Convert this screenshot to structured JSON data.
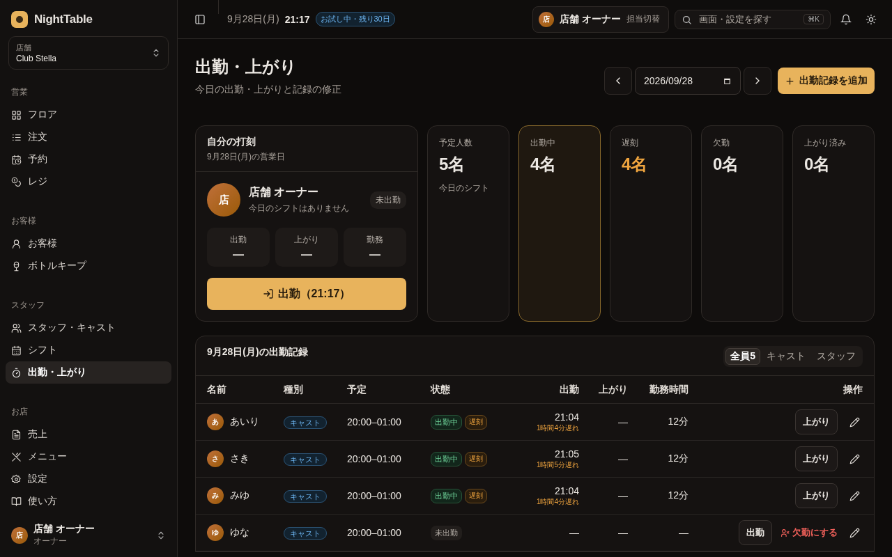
{
  "sidebar": {
    "brand": "NightTable",
    "store": {
      "label": "店舗",
      "name": "Club Stella"
    },
    "sections": [
      {
        "title": "営業",
        "items": [
          {
            "label": "フロア",
            "selected": false
          },
          {
            "label": "注文",
            "selected": false
          },
          {
            "label": "予約",
            "selected": false
          },
          {
            "label": "レジ",
            "selected": false
          }
        ]
      },
      {
        "title": "お客様",
        "items": [
          {
            "label": "お客様",
            "selected": false
          },
          {
            "label": "ボトルキープ",
            "selected": false
          }
        ]
      },
      {
        "title": "スタッフ",
        "items": [
          {
            "label": "スタッフ・キャスト",
            "selected": false
          },
          {
            "label": "シフト",
            "selected": false
          },
          {
            "label": "出勤・上がり",
            "selected": true
          }
        ]
      },
      {
        "title": "お店",
        "items": [
          {
            "label": "売上",
            "selected": false
          },
          {
            "label": "メニュー",
            "selected": false
          },
          {
            "label": "設定",
            "selected": false
          },
          {
            "label": "使い方",
            "selected": false
          }
        ]
      }
    ],
    "user": {
      "avatar": "店",
      "name": "店舗 オーナー",
      "role": "オーナー"
    }
  },
  "topbar": {
    "date": "9月28日(月)",
    "time": "21:17",
    "trial_badge": "お試し中・残り30日",
    "account": {
      "avatar": "店",
      "name": "店舗 オーナー",
      "switch_label": "担当切替"
    },
    "search": {
      "placeholder": "画面・設定を探す",
      "shortcut": "⌘K"
    }
  },
  "page": {
    "title": "出勤・上がり",
    "subtitle": "今日の出勤・上がりと記録の修正",
    "date_value": "2026/09/28",
    "add_button": "出勤記録を追加"
  },
  "my_clock": {
    "title": "自分の打刻",
    "subtitle": "9月28日(月)の営業日",
    "avatar": "店",
    "name": "店舗 オーナー",
    "note": "今日のシフトはありません",
    "status": "未出勤",
    "stats": [
      {
        "label": "出勤",
        "value": "—"
      },
      {
        "label": "上がり",
        "value": "—"
      },
      {
        "label": "勤務",
        "value": "—"
      }
    ],
    "button": "出勤（21:17）"
  },
  "summary": [
    {
      "label": "予定人数",
      "value": "5名",
      "note": "今日のシフト",
      "selected": false,
      "kind": "normal"
    },
    {
      "label": "出勤中",
      "value": "4名",
      "selected": true,
      "kind": "normal"
    },
    {
      "label": "遅刻",
      "value": "4名",
      "selected": false,
      "kind": "warning"
    },
    {
      "label": "欠勤",
      "value": "0名",
      "selected": false,
      "kind": "normal"
    },
    {
      "label": "上がり済み",
      "value": "0名",
      "selected": false,
      "kind": "normal"
    }
  ],
  "records": {
    "title": "9月28日(月)の出勤記録",
    "filters": [
      {
        "label": "全員",
        "count": "5",
        "selected": true
      },
      {
        "label": "キャスト",
        "selected": false
      },
      {
        "label": "スタッフ",
        "selected": false
      }
    ],
    "columns": [
      "名前",
      "種別",
      "予定",
      "状態",
      "出勤",
      "上がり",
      "勤務時間",
      "操作"
    ],
    "rows": [
      {
        "avatar": "あ",
        "name": "あいり",
        "type": "キャスト",
        "schedule": "20:00–01:00",
        "statuses": [
          {
            "label": "出勤中",
            "kind": "working"
          },
          {
            "label": "遅刻",
            "kind": "late"
          }
        ],
        "clock_in": "21:04",
        "late_note": "1時間4分遅れ",
        "clock_out": "—",
        "duration": "12分",
        "actions": [
          {
            "label": "上がり",
            "kind": "button"
          },
          {
            "kind": "edit"
          }
        ]
      },
      {
        "avatar": "さ",
        "name": "さき",
        "type": "キャスト",
        "schedule": "20:00–01:00",
        "statuses": [
          {
            "label": "出勤中",
            "kind": "working"
          },
          {
            "label": "遅刻",
            "kind": "late"
          }
        ],
        "clock_in": "21:05",
        "late_note": "1時間5分遅れ",
        "clock_out": "—",
        "duration": "12分",
        "actions": [
          {
            "label": "上がり",
            "kind": "button"
          },
          {
            "kind": "edit"
          }
        ]
      },
      {
        "avatar": "み",
        "name": "みゆ",
        "type": "キャスト",
        "schedule": "20:00–01:00",
        "statuses": [
          {
            "label": "出勤中",
            "kind": "working"
          },
          {
            "label": "遅刻",
            "kind": "late"
          }
        ],
        "clock_in": "21:04",
        "late_note": "1時間4分遅れ",
        "clock_out": "—",
        "duration": "12分",
        "actions": [
          {
            "label": "上がり",
            "kind": "button"
          },
          {
            "kind": "edit"
          }
        ]
      },
      {
        "avatar": "ゆ",
        "name": "ゆな",
        "type": "キャスト",
        "schedule": "20:00–01:00",
        "statuses": [
          {
            "label": "未出勤",
            "kind": "idle"
          }
        ],
        "clock_in": "—",
        "clock_out": "—",
        "duration": "—",
        "actions": [
          {
            "label": "出勤",
            "kind": "button"
          },
          {
            "label": "欠勤にする",
            "kind": "danger"
          },
          {
            "kind": "edit"
          }
        ]
      }
    ]
  }
}
